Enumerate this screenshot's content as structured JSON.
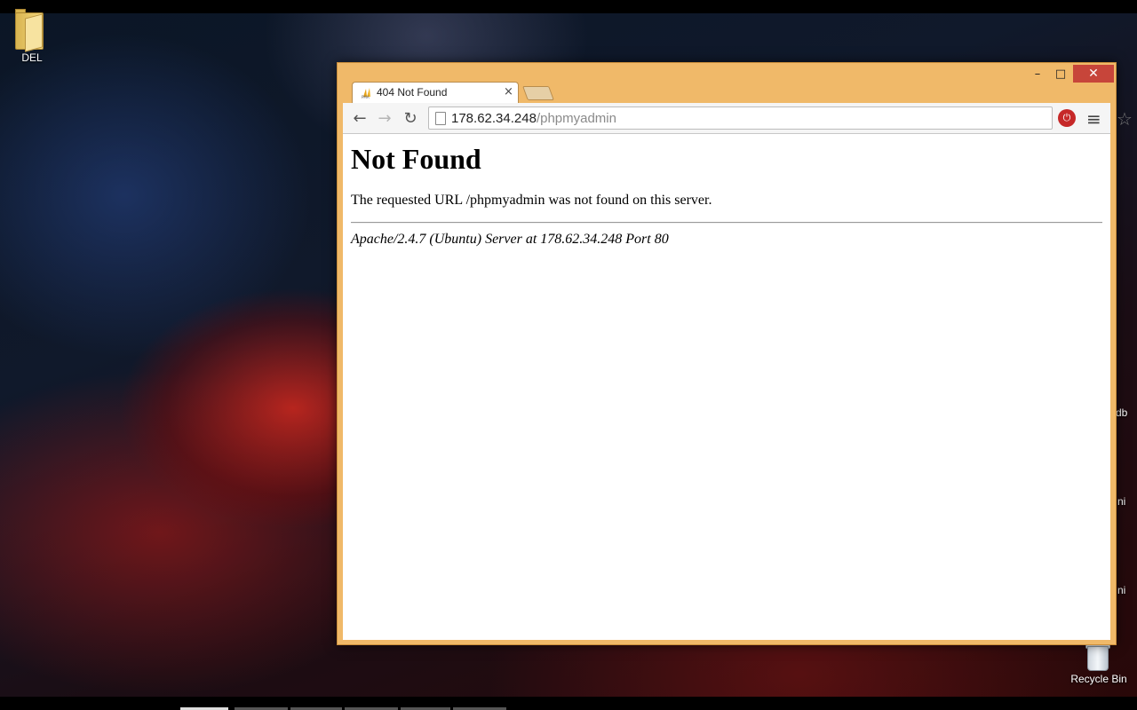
{
  "desktop": {
    "icons": [
      {
        "label": "DEL"
      },
      {
        "label": "Recycle Bin"
      }
    ],
    "edge_fragments": [
      "db",
      "ni",
      "ni"
    ]
  },
  "browser": {
    "tab": {
      "title": "404 Not Found",
      "close_glyph": "×",
      "favicon": "PMA"
    },
    "window_controls": {
      "minimize": "–",
      "maximize": "□",
      "close": "✕"
    },
    "nav": {
      "back": "←",
      "forward": "→",
      "reload": "↻"
    },
    "address": {
      "host": "178.62.34.248",
      "path": "/phpmyadmin"
    },
    "icons": {
      "star": "☆",
      "extension": "⏻",
      "menu": "≡"
    }
  },
  "page": {
    "heading": "Not Found",
    "message": "The requested URL /phpmyadmin was not found on this server.",
    "signature": "Apache/2.4.7 (Ubuntu) Server at 178.62.34.248 Port 80"
  }
}
